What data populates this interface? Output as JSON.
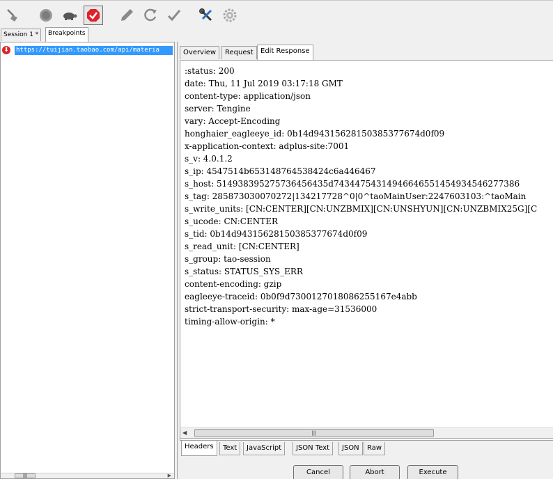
{
  "toolbar": {
    "buttons": [
      {
        "icon": "broom-icon"
      },
      {
        "icon": "record-icon"
      },
      {
        "icon": "turtle-icon"
      },
      {
        "icon": "breakpoint-icon",
        "active": true
      },
      {
        "icon": "pen-icon"
      },
      {
        "icon": "refresh-icon"
      },
      {
        "icon": "checkmark-icon"
      },
      {
        "icon": "tools-icon"
      },
      {
        "icon": "settings-gear-icon"
      }
    ]
  },
  "left_tabs": {
    "session": "Session 1 *",
    "breakpoints": "Breakpoints"
  },
  "breakpoint_list": {
    "items": [
      {
        "url": "https://tuijian.taobao.com/api/materia"
      }
    ]
  },
  "right_tabs": {
    "overview": "Overview",
    "request": "Request",
    "edit_response": "Edit Response"
  },
  "response": {
    "lines": [
      ":status: 200",
      "date: Thu, 11 Jul 2019 03:17:18 GMT",
      "content-type: application/json",
      "server: Tengine",
      "vary: Accept-Encoding",
      "honghaier_eagleeye_id: 0b14d94315628150385377674d0f09",
      "x-application-context: adplus-site:7001",
      "s_v: 4.0.1.2",
      "s_ip: 4547514b653148764538424c6a446467",
      "s_host: 514938395275736456435d74344754314946646551454934546277386",
      "s_tag: 285873030070272|134217728^0|0^taoMainUser:2247603103:^taoMain",
      "s_write_units: [CN:CENTER][CN:UNZBMIX][CN:UNSHYUN][CN:UNZBMIX25G][C",
      "s_ucode: CN:CENTER",
      "s_tid: 0b14d94315628150385377674d0f09",
      "s_read_unit: [CN:CENTER]",
      "s_group: tao-session",
      "s_status: STATUS_SYS_ERR",
      "content-encoding: gzip",
      "eagleeye-traceid: 0b0f9d7300127018086255167e4abb",
      "strict-transport-security: max-age=31536000",
      "timing-allow-origin: *"
    ]
  },
  "sub_tabs": {
    "headers": "Headers",
    "text": "Text",
    "javascript": "JavaScript",
    "json_text": "JSON Text",
    "json": "JSON",
    "raw": "Raw"
  },
  "actions": {
    "cancel": "Cancel",
    "abort": "Abort",
    "execute": "Execute"
  }
}
